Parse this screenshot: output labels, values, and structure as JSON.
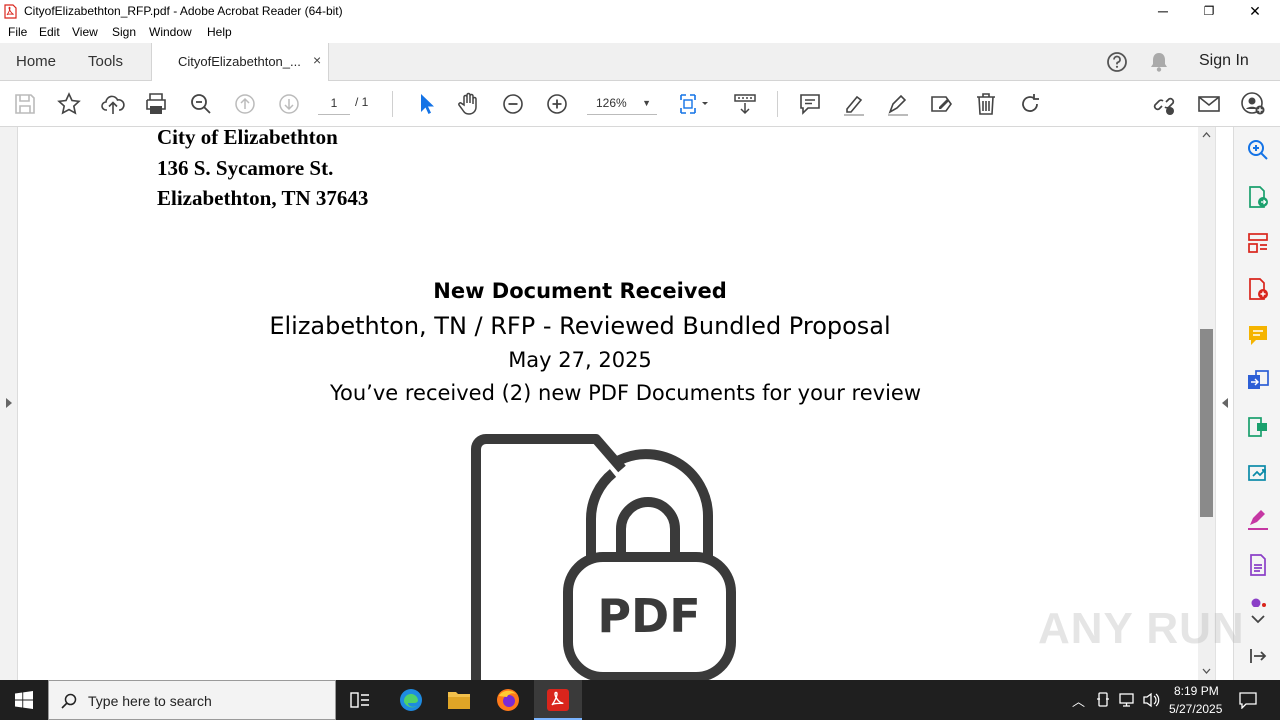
{
  "window": {
    "title": "CityofElizabethton_RFP.pdf - Adobe Acrobat Reader (64-bit)",
    "minimize": "─",
    "restore": "❐",
    "close": "✕"
  },
  "menu": [
    "File",
    "Edit",
    "View",
    "Sign",
    "Window",
    "Help"
  ],
  "tabs": {
    "home": "Home",
    "tools": "Tools",
    "document": "CityofElizabethton_...",
    "close": "×",
    "sign_in": "Sign In"
  },
  "toolbar": {
    "page_current": "1",
    "page_total": "/ 1",
    "zoom": "126%"
  },
  "document": {
    "address": [
      "City of Elizabethton",
      "136 S. Sycamore St.",
      "Elizabethton, TN 37643"
    ],
    "heading": "New Document Received",
    "subheading": "Elizabethton, TN / RFP - Reviewed Bundled Proposal",
    "date": "May 27, 2025",
    "message": "You’ve received (2) new PDF Documents for your review",
    "icon_label": "PDF"
  },
  "taskbar": {
    "search_placeholder": "Type here to search",
    "time": "8:19 PM",
    "date": "5/27/2025"
  },
  "watermark": "ANY RUN",
  "colors": {
    "acrobat_red": "#d9251c",
    "accent_blue": "#1473e6"
  }
}
